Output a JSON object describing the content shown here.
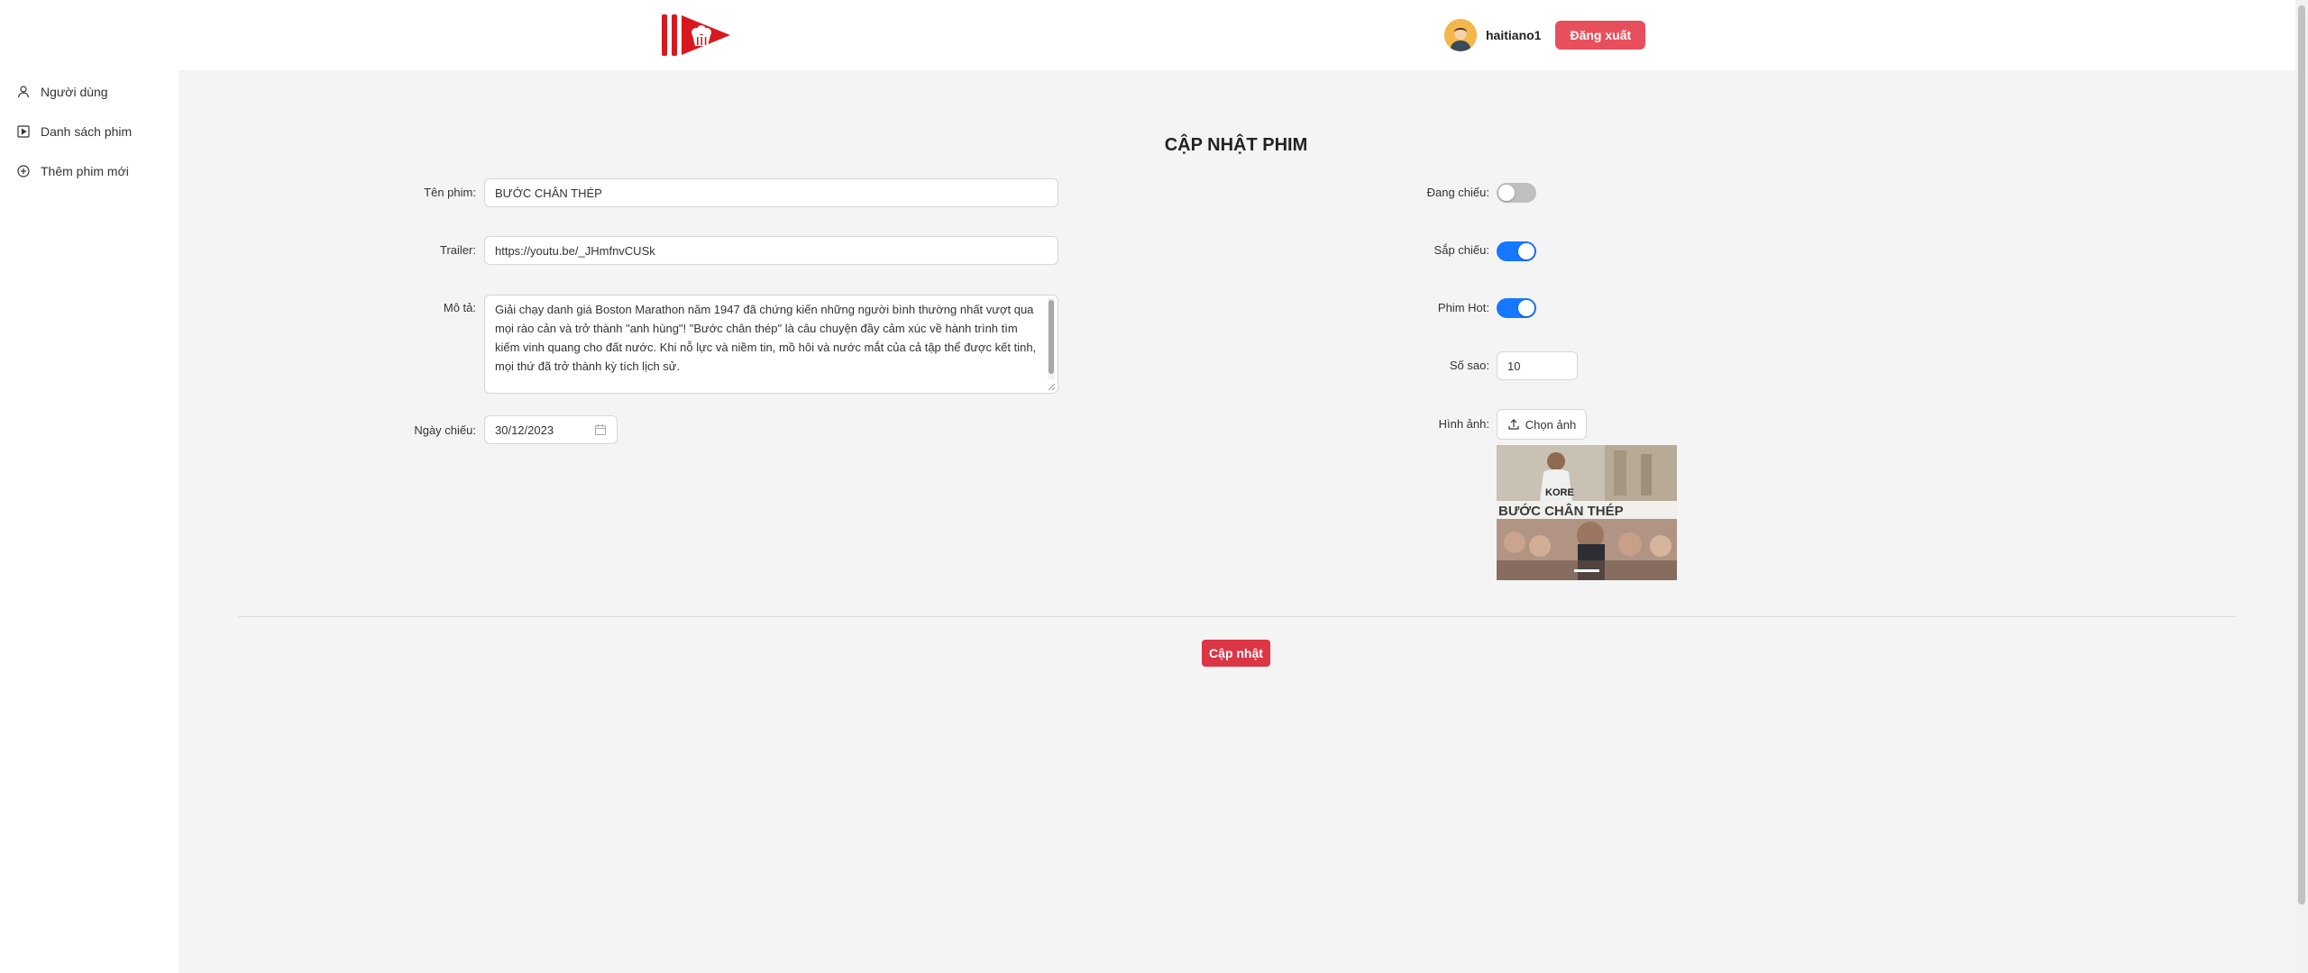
{
  "header": {
    "username": "haitiano1",
    "logout_label": "Đăng xuất"
  },
  "sidebar": {
    "items": [
      {
        "label": "Người dùng",
        "icon": "user-icon"
      },
      {
        "label": "Danh sách phim",
        "icon": "film-list-icon"
      },
      {
        "label": "Thêm phim mới",
        "icon": "plus-circle-icon"
      }
    ]
  },
  "form": {
    "title": "CẬP NHẬT PHIM",
    "name_label": "Tên phim",
    "name_value": "BƯỚC CHÂN THÉP",
    "trailer_label": "Trailer",
    "trailer_value": "https://youtu.be/_JHmfnvCUSk",
    "desc_label": "Mô tả",
    "desc_value": "Giải chạy danh giá Boston Marathon năm 1947 đã chứng kiến những người bình thường nhất vượt qua mọi rào cản và trở thành \"anh hùng\"! \"Bước chân thép\" là câu chuyện đầy cảm xúc về hành trình tìm kiếm vinh quang cho đất nước. Khi nỗ lực và niềm tin, mồ hôi và nước mắt của cả tập thể được kết tinh, mọi thứ đã trở thành kỳ tích lịch sử.",
    "date_label": "Ngày chiếu",
    "date_value": "30/12/2023",
    "showing_label": "Đang chiếu",
    "showing_on": false,
    "coming_label": "Sắp chiếu",
    "coming_on": true,
    "hot_label": "Phim Hot",
    "hot_on": true,
    "rating_label": "Số sao",
    "rating_value": "10",
    "image_label": "Hình ảnh",
    "upload_label": "Chọn ảnh",
    "poster_text": "BƯỚC CHÂN THÉP",
    "update_label": "Cập nhật"
  },
  "colors": {
    "logout": "#e84f5c",
    "update": "#dc3545",
    "toggle_on": "#1677ff",
    "toggle_off": "#bfbfbf",
    "logo_red": "#d7191f"
  }
}
